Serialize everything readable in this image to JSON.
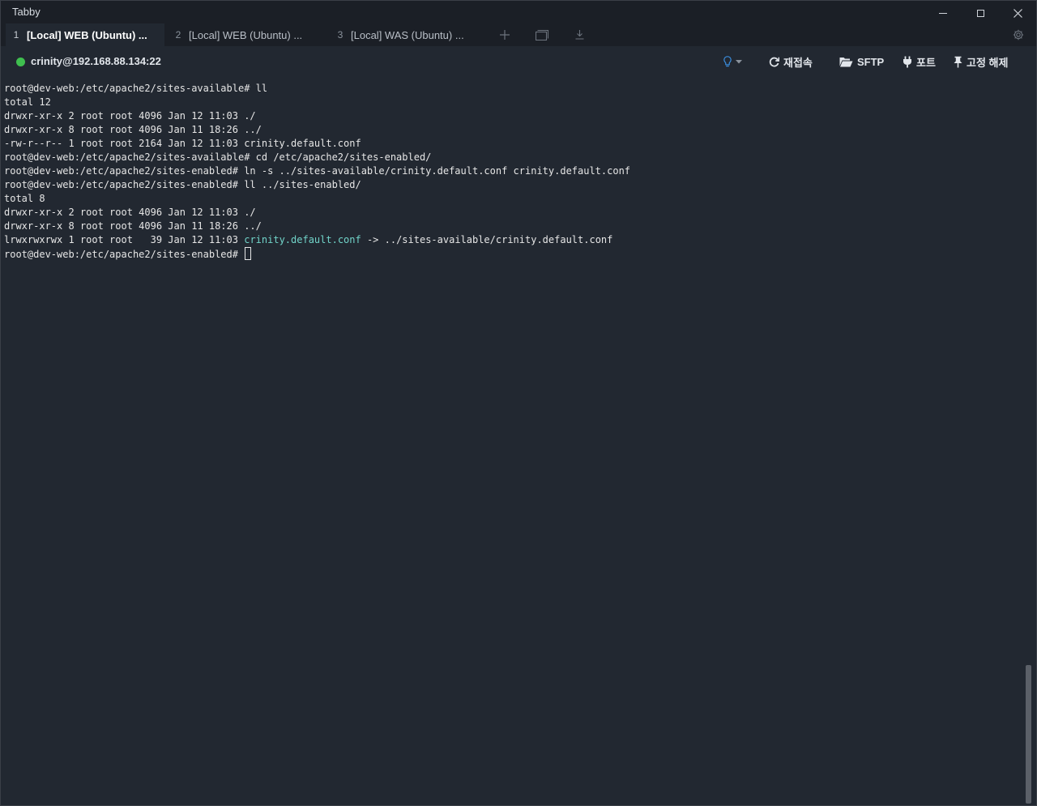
{
  "app": {
    "title": "Tabby"
  },
  "window_controls": {
    "minimize": "minimize-icon",
    "maximize": "maximize-icon",
    "close": "close-icon"
  },
  "tabs": [
    {
      "num": "1",
      "title": "[Local] WEB (Ubuntu) ...",
      "active": true
    },
    {
      "num": "2",
      "title": "[Local] WEB (Ubuntu) ...",
      "active": false
    },
    {
      "num": "3",
      "title": "[Local] WAS (Ubuntu) ...",
      "active": false
    }
  ],
  "tab_actions": {
    "new_tab": "plus-icon",
    "split": "window-icon",
    "download": "download-icon",
    "settings": "gear-icon"
  },
  "connection": {
    "label": "crinity@192.168.88.134:22",
    "status_color": "#3fbf4f"
  },
  "toolbar": {
    "reconnect": "재접속",
    "sftp": "SFTP",
    "ports": "포트",
    "unpin": "고정 해제",
    "hint_icon": "lightbulb-icon"
  },
  "terminal": {
    "lines": [
      "root@dev-web:/etc/apache2/sites-available# ll",
      "total 12",
      "drwxr-xr-x 2 root root 4096 Jan 12 11:03 ./",
      "drwxr-xr-x 8 root root 4096 Jan 11 18:26 ../",
      "-rw-r--r-- 1 root root 2164 Jan 12 11:03 crinity.default.conf",
      "root@dev-web:/etc/apache2/sites-available# cd /etc/apache2/sites-enabled/",
      "root@dev-web:/etc/apache2/sites-enabled# ln -s ../sites-available/crinity.default.conf crinity.default.conf",
      "root@dev-web:/etc/apache2/sites-enabled# ll ../sites-enabled/",
      "total 8",
      "drwxr-xr-x 2 root root 4096 Jan 12 11:03 ./",
      "drwxr-xr-x 8 root root 4096 Jan 11 18:26 ../"
    ],
    "link_line": {
      "prefix": "lrwxrwxrwx 1 root root   39 Jan 12 11:03 ",
      "name": "crinity.default.conf",
      "suffix": " -> ../sites-available/crinity.default.conf"
    },
    "prompt": "root@dev-web:/etc/apache2/sites-enabled# ",
    "link_color": "#71d4c9"
  }
}
